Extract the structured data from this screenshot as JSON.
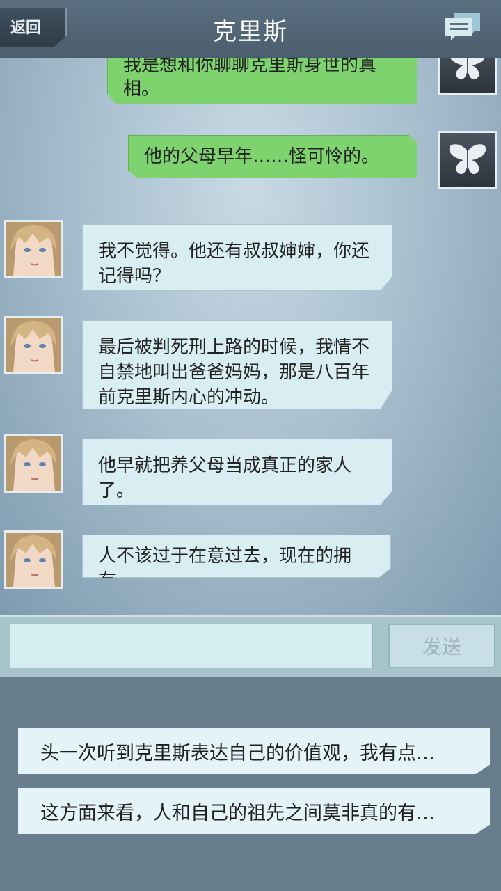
{
  "header": {
    "back_label": "返回",
    "title": "克里斯",
    "chat_icon": "chat-bubbles-icon"
  },
  "messages": [
    {
      "sender": "self",
      "text": "我是想和你聊聊克里斯身世的真相。"
    },
    {
      "sender": "self",
      "text": "他的父母早年……怪可怜的。"
    },
    {
      "sender": "chris",
      "text": "我不觉得。他还有叔叔婶婶，你还记得吗？"
    },
    {
      "sender": "chris",
      "text": "最后被判死刑上路的时候，我情不自禁地叫出爸爸妈妈，那是八百年前克里斯内心的冲动。"
    },
    {
      "sender": "chris",
      "text": "他早就把养父母当成真正的家人了。"
    },
    {
      "sender": "chris",
      "text": "人不该过于在意过去，现在的拥有。"
    }
  ],
  "input": {
    "value": "",
    "send_label": "发送"
  },
  "options": [
    {
      "text": "头一次听到克里斯表达自己的价值观，我有点…"
    },
    {
      "text": "这方面来看，人和自己的祖先之间莫非真的有…"
    }
  ],
  "colors": {
    "self_bubble": "#7ed36f",
    "other_bubble": "#d8eef3",
    "header_bg": "#4a5e6e"
  }
}
